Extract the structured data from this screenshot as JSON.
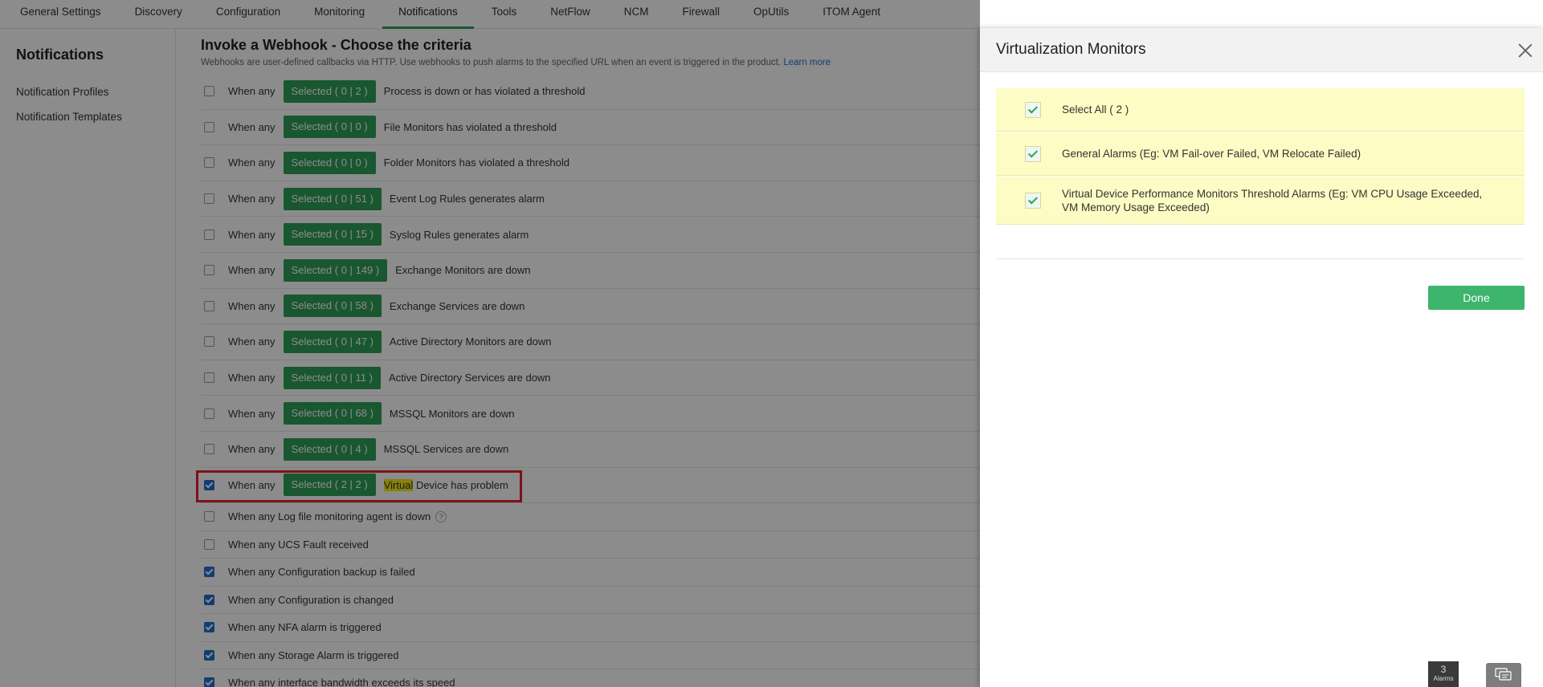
{
  "topnav": {
    "tabs": [
      "General Settings",
      "Discovery",
      "Configuration",
      "Monitoring",
      "Notifications",
      "Tools",
      "NetFlow",
      "NCM",
      "Firewall",
      "OpUtils",
      "ITOM Agent"
    ]
  },
  "sidebar": {
    "title": "Notifications",
    "items": [
      "Notification Profiles",
      "Notification Templates"
    ]
  },
  "main": {
    "title": "Invoke a Webhook - Choose the criteria",
    "description": "Webhooks are user-defined callbacks via HTTP. Use webhooks to push alarms to the specified URL when an event is triggered in the product.",
    "learn_more": "Learn more",
    "when_any": "When any",
    "criteria": [
      {
        "selected": "Selected ( 0 | 2 )",
        "label": "Process is down or has violated a threshold",
        "checked": false
      },
      {
        "selected": "Selected ( 0 | 0 )",
        "label": "File Monitors has violated a threshold",
        "checked": false
      },
      {
        "selected": "Selected ( 0 | 0 )",
        "label": "Folder Monitors has violated a threshold",
        "checked": false
      },
      {
        "selected": "Selected ( 0 | 51 )",
        "label": "Event Log Rules generates alarm",
        "checked": false
      },
      {
        "selected": "Selected ( 0 | 15 )",
        "label": "Syslog Rules generates alarm",
        "checked": false
      },
      {
        "selected": "Selected ( 0 | 149 )",
        "label": "Exchange Monitors are down",
        "checked": false
      },
      {
        "selected": "Selected ( 0 | 58 )",
        "label": "Exchange Services are down",
        "checked": false
      },
      {
        "selected": "Selected ( 0 | 47 )",
        "label": "Active Directory Monitors are down",
        "checked": false
      },
      {
        "selected": "Selected ( 0 | 11 )",
        "label": "Active Directory Services are down",
        "checked": false
      },
      {
        "selected": "Selected ( 0 | 68 )",
        "label": "MSSQL Monitors are down",
        "checked": false
      },
      {
        "selected": "Selected ( 0 | 4 )",
        "label": "MSSQL Services are down",
        "checked": false
      }
    ],
    "virtual_row": {
      "selected": "Selected ( 2 | 2 )",
      "highlight": "Virtual",
      "label_rest": " Device has problem",
      "checked": true
    },
    "simple_criteria": [
      {
        "label": "When any Log file monitoring agent is down",
        "checked": false,
        "help": "?"
      },
      {
        "label": "When any UCS Fault received",
        "checked": false
      },
      {
        "label": "When any Configuration backup is failed",
        "checked": true
      },
      {
        "label": "When any Configuration is changed",
        "checked": true
      },
      {
        "label": "When any NFA alarm is triggered",
        "checked": true
      },
      {
        "label": "When any Storage Alarm is triggered",
        "checked": true
      },
      {
        "label": "When any interface bandwidth exceeds its speed",
        "checked": true
      }
    ]
  },
  "panel": {
    "title": "Virtualization Monitors",
    "options": [
      "Select All ( 2 )",
      "General Alarms (Eg: VM Fail-over Failed, VM Relocate Failed)",
      "Virtual Device Performance Monitors Threshold Alarms (Eg: VM CPU Usage Exceeded, VM Memory Usage Exceeded)"
    ],
    "done_label": "Done"
  },
  "footer": {
    "alarm_count": "3",
    "alarm_label": "Alarms"
  },
  "colors": {
    "accent_green": "#2f9e58",
    "done_green": "#3db56c",
    "highlight_yellow": "#f4ec17",
    "option_bg": "#fdfcc4",
    "red_box": "#e2212a"
  }
}
